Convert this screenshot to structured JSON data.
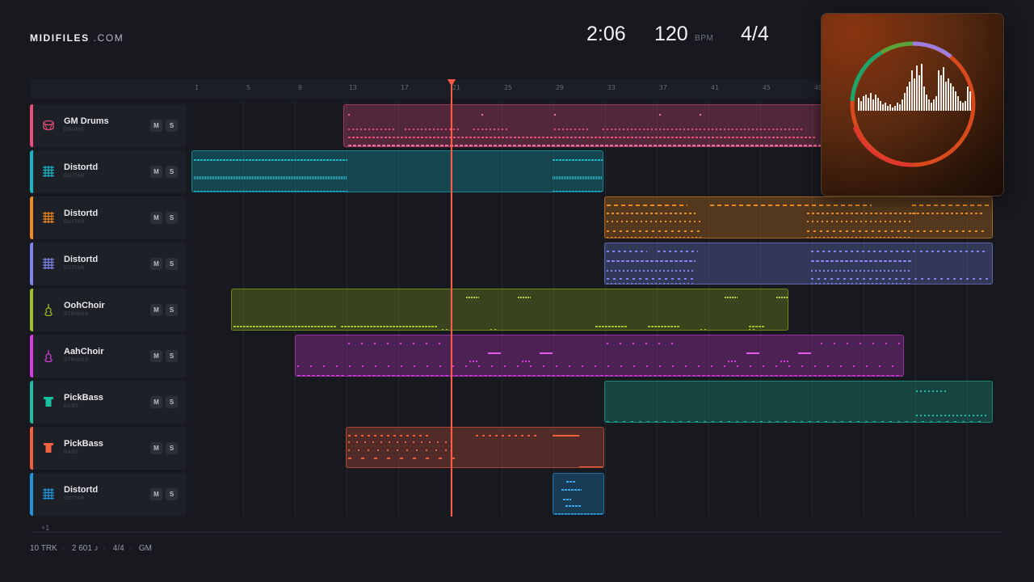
{
  "brand": {
    "name": "MIDIFILES",
    "suffix": ".COM"
  },
  "transport": {
    "time": "2:06",
    "tempo": "120",
    "tempo_unit": "BPM",
    "time_signature": "4/4"
  },
  "ruler": {
    "bars": [
      "1",
      "5",
      "9",
      "13",
      "17",
      "21",
      "25",
      "29",
      "33",
      "37",
      "41",
      "45",
      "49"
    ]
  },
  "playhead_bar": 21,
  "tracks": [
    {
      "name": "GM Drums",
      "category": "DRUMS",
      "color": "#e84d7c",
      "icon": "drum-icon",
      "mute": "M",
      "solo": "S"
    },
    {
      "name": "Distortd",
      "category": "GUITAR",
      "color": "#16b6c8",
      "icon": "guitar-grid-icon",
      "mute": "M",
      "solo": "S"
    },
    {
      "name": "Distortd",
      "category": "GUITAR",
      "color": "#f08a1e",
      "icon": "guitar-grid-icon",
      "mute": "M",
      "solo": "S"
    },
    {
      "name": "Distortd",
      "category": "GUITAR",
      "color": "#7d86ee",
      "icon": "guitar-grid-icon",
      "mute": "M",
      "solo": "S"
    },
    {
      "name": "OohChoir",
      "category": "STRINGS",
      "color": "#9cc21f",
      "icon": "violin-icon",
      "mute": "M",
      "solo": "S"
    },
    {
      "name": "AahChoir",
      "category": "STRINGS",
      "color": "#d83be0",
      "icon": "violin-icon",
      "mute": "M",
      "solo": "S"
    },
    {
      "name": "PickBass",
      "category": "BASS",
      "color": "#18c0a2",
      "icon": "bass-icon",
      "mute": "M",
      "solo": "S"
    },
    {
      "name": "PickBass",
      "category": "BASS",
      "color": "#f2613f",
      "icon": "bass-icon",
      "mute": "M",
      "solo": "S"
    },
    {
      "name": "Distortd",
      "category": "GUITAR",
      "color": "#1f96e0",
      "icon": "guitar-grid-icon",
      "mute": "M",
      "solo": "S"
    }
  ],
  "more_tracks": "+1",
  "footer": {
    "tracks": "10 TRK",
    "notes": "2 601 ♪",
    "signature": "4/4",
    "mode": "GM"
  },
  "colors": {
    "background": "#17191f",
    "playhead": "#ff5a48",
    "panel": "#1e2027"
  }
}
